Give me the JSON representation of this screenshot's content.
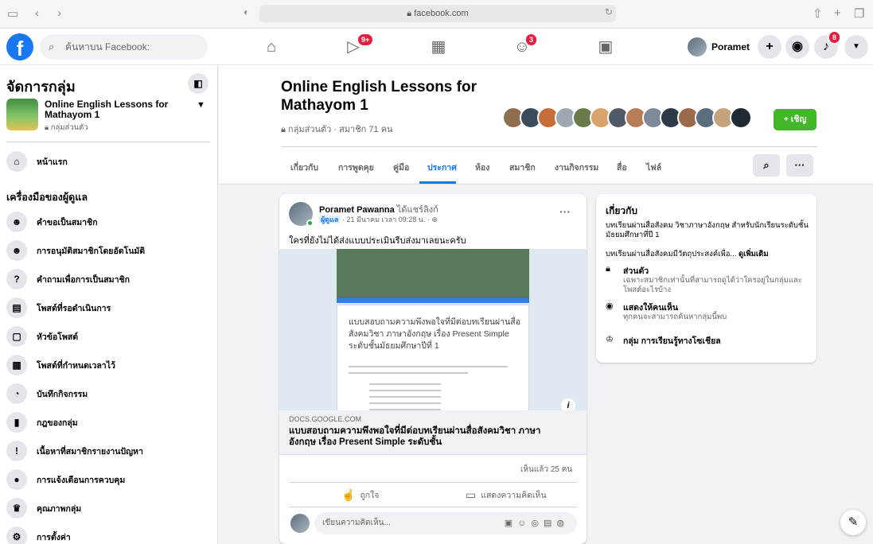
{
  "browser": {
    "url": "facebook.com",
    "icons": [
      "sidebar-toggle-icon",
      "back-icon",
      "forward-icon",
      "privacy-shield-icon",
      "reload-icon",
      "share-icon",
      "new-tab-icon",
      "tabs-overview-icon"
    ]
  },
  "topnav": {
    "search_placeholder": "ค้นหาบน Facebook:",
    "watch_badge": "9+",
    "groups_badge": "3",
    "notifications_badge": "8",
    "profile_name": "Poramet"
  },
  "sidebar": {
    "title": "จัดการกลุ่ม",
    "group_name": "Online English Lessons for Mathayom 1",
    "group_privacy": "กลุ่มส่วนตัว",
    "home_label": "หน้าแรก",
    "admin_tools_title": "เครื่องมือของผู้ดูแล",
    "items": [
      {
        "label": "คำขอเป็นสมาชิก",
        "icon": "member-request-icon"
      },
      {
        "label": "การอนุมัติสมาชิกโดยอัตโนมัติ",
        "icon": "auto-approve-icon"
      },
      {
        "label": "คำถามเพื่อการเป็นสมาชิก",
        "icon": "membership-questions-icon"
      },
      {
        "label": "โพสต์ที่รอดำเนินการ",
        "icon": "pending-posts-icon"
      },
      {
        "label": "หัวข้อโพสต์",
        "icon": "post-topics-icon"
      },
      {
        "label": "โพสต์ที่กำหนดเวลาไว้",
        "icon": "scheduled-posts-icon"
      },
      {
        "label": "บันทึกกิจกรรม",
        "icon": "activity-log-icon"
      },
      {
        "label": "กฎของกลุ่ม",
        "icon": "group-rules-icon"
      },
      {
        "label": "เนื้อหาที่สมาชิกรายงานปัญหา",
        "icon": "reported-content-icon"
      },
      {
        "label": "การแจ้งเตือนการควบคุม",
        "icon": "moderation-alerts-icon"
      },
      {
        "label": "คุณภาพกลุ่ม",
        "icon": "group-quality-icon"
      },
      {
        "label": "การตั้งค่า",
        "icon": "settings-icon"
      }
    ]
  },
  "group": {
    "title": "Online English Lessons for Mathayom 1",
    "meta": "กลุ่มส่วนตัว · สมาชิก 71 คน",
    "invite_label": "+ เชิญ",
    "tabs": [
      "เกี่ยวกับ",
      "การพูดคุย",
      "คู่มือ",
      "ประกาศ",
      "ห้อง",
      "สมาชิก",
      "งานกิจกรรม",
      "สื่อ",
      "ไฟล์"
    ],
    "active_tab": "ประกาศ",
    "more_label": "···"
  },
  "post": {
    "author": "Poramet Pawanna",
    "shared_text": "ได้แชร์ลิงก์",
    "role": "ผู้ดูแล",
    "timestamp": "· 21 มีนาคม เวลา 09:28 น. ·",
    "more_label": "···",
    "text": "ใครที่ยังไม่ได้ส่งแบบประเมินรีบส่งมาเลยนะครับ",
    "image_doc_title": "แบบสอบถามความพึงพอใจที่มีต่อบทเรียนผ่านสื่อสังคมวิชา ภาษาอังกฤษ เรื่อง Present Simple ระดับชั้นมัธยมศึกษาปีที่ 1",
    "link_domain": "DOCS.GOOGLE.COM",
    "link_title": "แบบสอบถามความพึงพอใจที่มีต่อบทเรียนผ่านสื่อสังคมวิชา ภาษาอังกฤษ เรื่อง Present Simple ระดับชั้น",
    "seen": "เห็นแล้ว 25 คน",
    "like_label": "ถูกใจ",
    "comment_label": "แสดงความคิดเห็น",
    "comment_placeholder": "เขียนความคิดเห็น..."
  },
  "about": {
    "title": "เกี่ยวกับ",
    "desc": "บทเรียนผ่านสื่อสังคม วิชาภาษาอังกฤษ สำหรับนักเรียนระดับชั้นมัธยมศึกษาที่ปี 1",
    "desc2": "บทเรียนผ่านสื่อสังคมมีวัตถุประสงค์เพื่อ...",
    "see_more": "ดูเพิ่มเติม",
    "private_title": "ส่วนตัว",
    "private_desc": "เฉพาะสมาชิกเท่านั้นที่สามารถดูได้ว่าใครอยู่ในกลุ่มและโพสต์อะไรบ้าง",
    "visible_title": "แสดงให้คนเห็น",
    "visible_desc": "ทุกคนจะสามารถค้นหากลุ่มนี้พบ",
    "type_title": "กลุ่ม การเรียนรู้ทางโซเชียล"
  },
  "colors": {
    "brand": "#1877f2",
    "invite": "#42b72a",
    "badge": "#e41e3f"
  }
}
